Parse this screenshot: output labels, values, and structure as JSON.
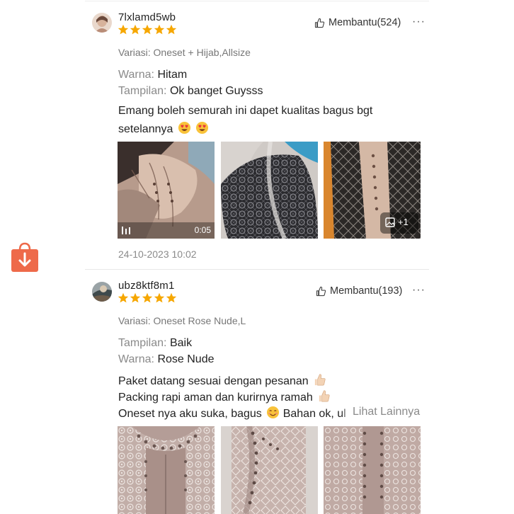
{
  "reviews": [
    {
      "username": "7lxlamd5wb",
      "rating": 5,
      "helpful_label": "Membantu(524)",
      "more_icon": "more-dots-icon",
      "variant": "Variasi: Oneset + Hijab,Allsize",
      "attributes": [
        {
          "key": "Warna:",
          "value": "Hitam"
        },
        {
          "key": "Tampilan:",
          "value": "Ok banget Guysss"
        }
      ],
      "body_lines": [
        "Emang boleh semurah ini dapet kualitas bagus bgt",
        "setelannya"
      ],
      "video_duration": "0:05",
      "more_media_label": "+1",
      "timestamp": "24-10-2023 10:02"
    },
    {
      "username": "ubz8ktf8m1",
      "rating": 5,
      "helpful_label": "Membantu(193)",
      "more_icon": "more-dots-icon",
      "variant": "Variasi: Oneset Rose Nude,L",
      "attributes": [
        {
          "key": "Tampilan:",
          "value": "Baik"
        },
        {
          "key": "Warna:",
          "value": "Rose Nude"
        }
      ],
      "body_lines": [
        "Paket datang sesuai dengan pesanan",
        "Packing rapi aman dan kurirnya ramah",
        "Oneset nya aku suka, bagus",
        "Bahan ok, ul"
      ],
      "see_more_label": "Lihat Lainnya"
    }
  ],
  "colors": {
    "star": "#f6a700",
    "bag": "#ee6a4a"
  }
}
